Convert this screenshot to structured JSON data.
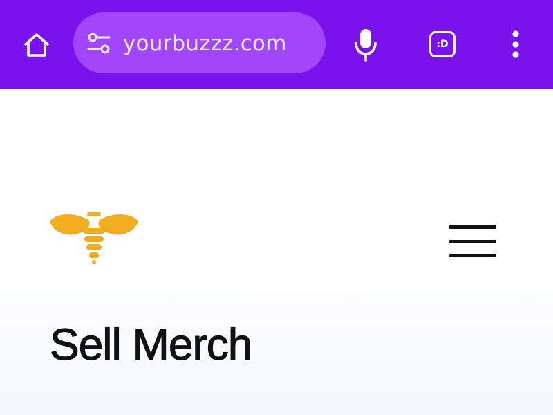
{
  "browser": {
    "url": "yourbuzzz.com",
    "tab_count_label": ":D",
    "colors": {
      "toolbar": "#7a12ee",
      "omnibox": "#a146fb",
      "icon": "#ffffff"
    },
    "icons": [
      "home-icon",
      "tune-icon",
      "microphone-icon",
      "tab-switcher-icon",
      "more-vert-icon"
    ]
  },
  "page": {
    "logo_icon": "bee-logo-icon",
    "logo_color": "#f2ac1f",
    "menu_icon": "hamburger-menu-icon",
    "headline": "Sell Merch"
  }
}
